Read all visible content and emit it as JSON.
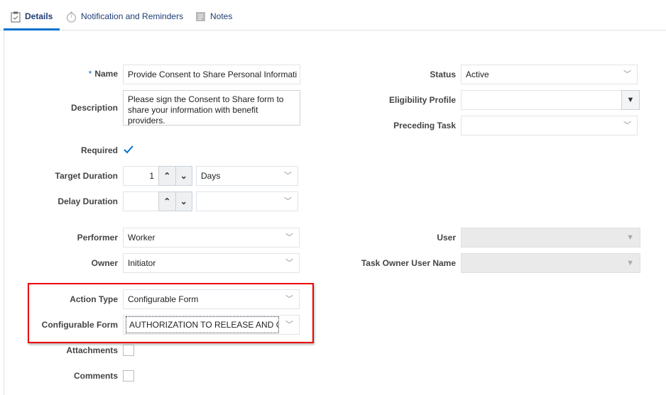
{
  "tabs": [
    {
      "label": "Details",
      "icon": "clipboard-icon"
    },
    {
      "label": "Notification and Reminders",
      "icon": "stopwatch-icon"
    },
    {
      "label": "Notes",
      "icon": "note-icon"
    }
  ],
  "form": {
    "name_label": "Name",
    "name_value": "Provide Consent to Share Personal Informati",
    "description_label": "Description",
    "description_value": "Please sign the Consent to Share form to share your information with benefit providers.",
    "required_label": "Required",
    "required_checked": true,
    "target_duration_label": "Target Duration",
    "target_duration_value": "1",
    "target_duration_unit": "Days",
    "delay_duration_label": "Delay Duration",
    "delay_duration_value": "",
    "delay_duration_unit": "",
    "performer_label": "Performer",
    "performer_value": "Worker",
    "owner_label": "Owner",
    "owner_value": "Initiator",
    "action_type_label": "Action Type",
    "action_type_value": "Configurable Form",
    "configurable_form_label": "Configurable Form",
    "configurable_form_value": "AUTHORIZATION TO RELEASE AND C",
    "attachments_label": "Attachments",
    "comments_label": "Comments",
    "status_label": "Status",
    "status_value": "Active",
    "eligibility_label": "Eligibility Profile",
    "eligibility_value": "",
    "preceding_label": "Preceding Task",
    "preceding_value": "",
    "user_label": "User",
    "user_value": "",
    "task_owner_label": "Task Owner User Name",
    "task_owner_value": "",
    "required_star": "*"
  },
  "colors": {
    "accent": "#0572ce",
    "highlight": "#ee0000",
    "check": "#0572ce"
  }
}
